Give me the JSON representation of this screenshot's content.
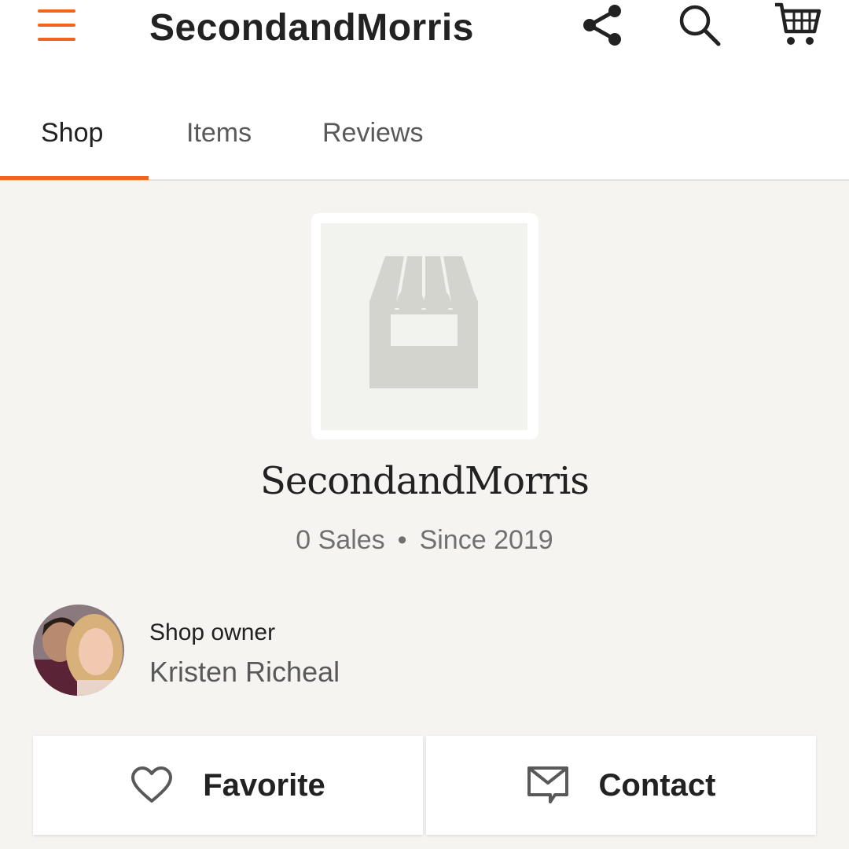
{
  "header": {
    "title": "SecondandMorris",
    "accent_color": "#f1641e",
    "icons": [
      "menu-icon",
      "share-icon",
      "search-icon",
      "cart-icon"
    ]
  },
  "tabs": [
    {
      "label": "Shop",
      "active": true
    },
    {
      "label": "Items",
      "active": false
    },
    {
      "label": "Reviews",
      "active": false
    }
  ],
  "shop": {
    "name": "SecondandMorris",
    "sales": "0 Sales",
    "separator": "•",
    "since": "Since 2019"
  },
  "owner": {
    "label": "Shop owner",
    "name": "Kristen Richeal"
  },
  "actions": {
    "favorite_label": "Favorite",
    "contact_label": "Contact"
  }
}
